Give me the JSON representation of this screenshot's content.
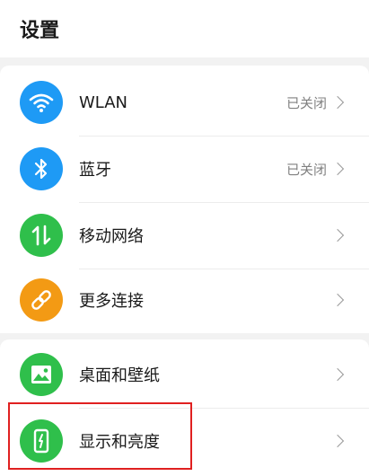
{
  "header": {
    "title": "设置"
  },
  "colors": {
    "wifi": "#1e9af5",
    "bluetooth": "#1e9af5",
    "mobile": "#2fbf4b",
    "more": "#f39a14",
    "wallpaper": "#2fbf4b",
    "display": "#2fbf4b",
    "highlight": "#e02020"
  },
  "group1": [
    {
      "label": "WLAN",
      "status": "已关闭",
      "icon": "wifi-icon"
    },
    {
      "label": "蓝牙",
      "status": "已关闭",
      "icon": "bluetooth-icon"
    },
    {
      "label": "移动网络",
      "icon": "mobile-data-icon"
    },
    {
      "label": "更多连接",
      "icon": "link-icon"
    }
  ],
  "group2": [
    {
      "label": "桌面和壁纸",
      "icon": "image-icon"
    },
    {
      "label": "显示和亮度",
      "icon": "phone-brightness-icon"
    }
  ]
}
